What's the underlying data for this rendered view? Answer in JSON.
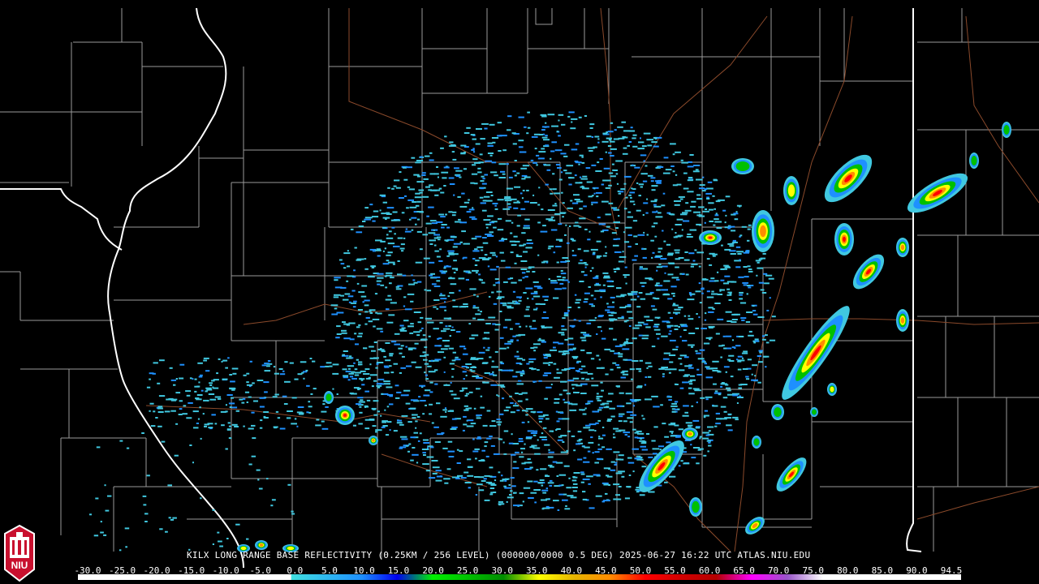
{
  "product": {
    "title": "KILX LONG RANGE BASE REFLECTIVITY (0.25KM / 256 LEVEL) (000000/0000 0.5 DEG) 2025-06-27 16:22 UTC  ATLAS.NIU.EDU"
  },
  "logo": {
    "text": "NIU",
    "color": "#c8102e"
  },
  "color_scale": {
    "labels": [
      "-30.0",
      "-25.0",
      "-20.0",
      "-15.0",
      "-10.0",
      "-5.0",
      "0.0",
      "5.0",
      "10.0",
      "15.0",
      "20.0",
      "25.0",
      "30.0",
      "35.0",
      "40.0",
      "45.0",
      "50.0",
      "55.0",
      "60.0",
      "65.0",
      "70.0",
      "75.0",
      "80.0",
      "85.0",
      "90.0",
      "94.5"
    ],
    "stops": [
      {
        "value": -30,
        "color": "#ffffff"
      },
      {
        "value": 0,
        "color": "#ffffff"
      },
      {
        "value": 0.1,
        "color": "#40e0e0"
      },
      {
        "value": 10,
        "color": "#1e90ff"
      },
      {
        "value": 15,
        "color": "#0000f0"
      },
      {
        "value": 20,
        "color": "#00f000"
      },
      {
        "value": 25,
        "color": "#00c000"
      },
      {
        "value": 30,
        "color": "#008c00"
      },
      {
        "value": 35,
        "color": "#ffff00"
      },
      {
        "value": 40,
        "color": "#e6b400"
      },
      {
        "value": 45,
        "color": "#ff8c00"
      },
      {
        "value": 50,
        "color": "#ff0000"
      },
      {
        "value": 55,
        "color": "#d20000"
      },
      {
        "value": 60,
        "color": "#b40000"
      },
      {
        "value": 65,
        "color": "#ff00ff"
      },
      {
        "value": 70,
        "color": "#9955c9"
      },
      {
        "value": 75,
        "color": "#ffffff"
      },
      {
        "value": 94.5,
        "color": "#ffffff"
      }
    ]
  },
  "colors": {
    "background": "#000000",
    "county_lines": "#9a9a9a",
    "state_lines": "#ffffff",
    "highways": "#8b4a2b",
    "echo_light": "#40c8e0",
    "echo_blue": "#1e90ff",
    "echo_green": "#00c000",
    "echo_yellow": "#ffff00",
    "echo_orange": "#ff8c00",
    "echo_red": "#ff0000"
  }
}
